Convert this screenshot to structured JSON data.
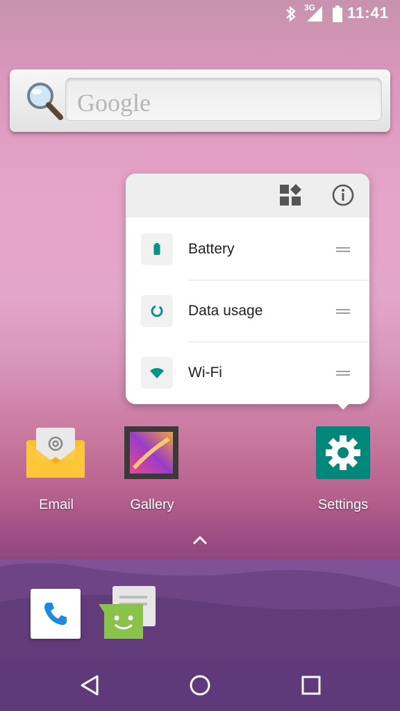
{
  "status_bar": {
    "network": "3G",
    "time": "11:41"
  },
  "search_widget": {
    "placeholder": "Google"
  },
  "shortcut_popup": {
    "items": [
      {
        "label": "Battery",
        "icon": "battery-icon"
      },
      {
        "label": "Data usage",
        "icon": "data-usage-icon"
      },
      {
        "label": "Wi-Fi",
        "icon": "wifi-icon"
      }
    ]
  },
  "apps": [
    {
      "label": "Email",
      "icon": "email-icon"
    },
    {
      "label": "Gallery",
      "icon": "gallery-icon"
    },
    {
      "label": "Settings",
      "icon": "settings-icon"
    }
  ],
  "dock": [
    {
      "icon": "phone-icon"
    },
    {
      "icon": "messaging-icon"
    }
  ],
  "colors": {
    "accent": "#009688",
    "settings_bg": "#00897b",
    "email_yellow": "#f9c02c"
  }
}
